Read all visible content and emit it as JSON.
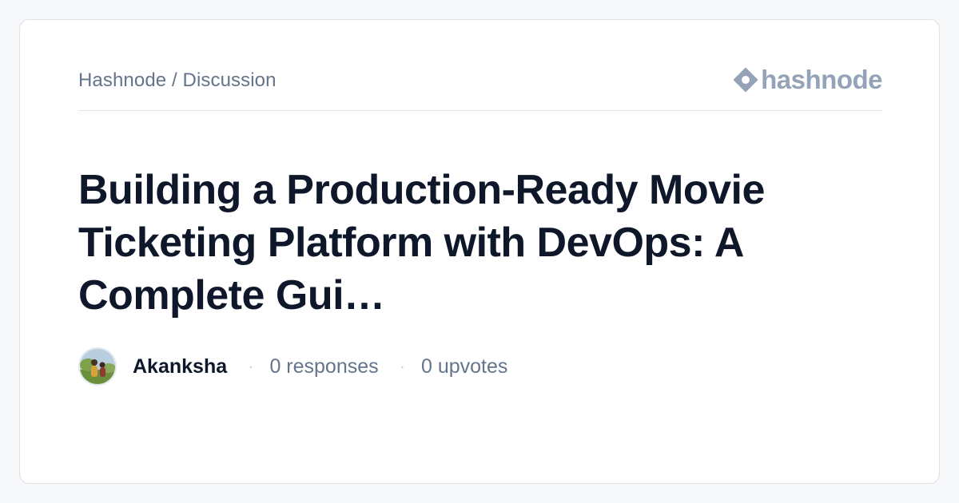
{
  "breadcrumb": "Hashnode / Discussion",
  "brand": {
    "name": "hashnode",
    "logo_icon": "hashnode-diamond-icon",
    "color": "#94a3b8"
  },
  "title": "Building a Production-Ready Movie Ticketing Platform with DevOps: A Complete Gui…",
  "author": {
    "name": "Akanksha",
    "avatar_icon": "user-avatar-photo"
  },
  "stats": {
    "separator": "·",
    "responses": "0 responses",
    "upvotes": "0 upvotes"
  },
  "colors": {
    "title": "#0f172a",
    "muted": "#64748b",
    "background": "#f7f8fa",
    "card": "#ffffff"
  }
}
